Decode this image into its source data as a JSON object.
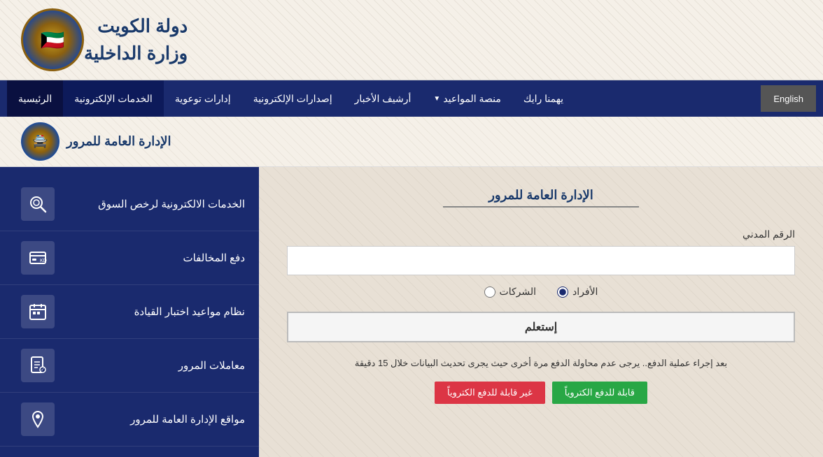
{
  "header": {
    "title_line1": "دولة الكويت",
    "title_line2": "وزارة الداخلية"
  },
  "nav": {
    "english_label": "English",
    "items": [
      {
        "id": "home",
        "label": "الرئيسية",
        "active": true
      },
      {
        "id": "eservices",
        "label": "الخدمات الإلكترونية",
        "active": true
      },
      {
        "id": "educational",
        "label": "إدارات توعوية"
      },
      {
        "id": "publications",
        "label": "إصدارات الإلكترونية"
      },
      {
        "id": "news",
        "label": "أرشيف الأخبار"
      },
      {
        "id": "appointments",
        "label": "منصة المواعيد",
        "has_dropdown": true
      },
      {
        "id": "opinion",
        "label": "يهمنا رايك"
      }
    ]
  },
  "breadcrumb": {
    "title": "الإدارة العامة للمرور"
  },
  "form": {
    "section_title": "الإدارة العامة للمرور",
    "civil_id_label": "الرقم المدني",
    "civil_id_placeholder": "",
    "radio_individuals": "الأفراد",
    "radio_companies": "الشركات",
    "submit_label": "إستعلم",
    "info_text": "بعد إجراء عملية الدفع.. يرجى عدم محاولة الدفع مرة أخرى حيث يجرى تحديث البيانات خلال 15 دقيقة",
    "status_eligible": "قابلة للدفع الكتروياً",
    "status_not_eligible": "غير قابلة للدفع الكتروياً"
  },
  "sidebar": {
    "items": [
      {
        "id": "license-services",
        "label": "الخدمات الالكترونية لرخص السوق",
        "icon": "🔍"
      },
      {
        "id": "pay-fines",
        "label": "دفع المخالفات",
        "icon": "💳"
      },
      {
        "id": "driving-test",
        "label": "نظام مواعيد اختبار القيادة",
        "icon": "📋"
      },
      {
        "id": "traffic-transactions",
        "label": "معاملات المرور",
        "icon": "📄"
      },
      {
        "id": "traffic-locations",
        "label": "مواقع الإدارة العامة للمرور",
        "icon": "📍"
      }
    ]
  }
}
